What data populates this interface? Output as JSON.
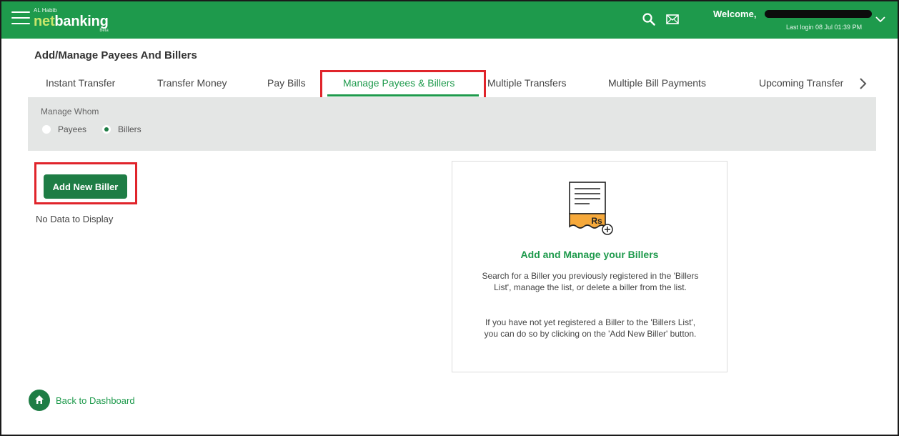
{
  "header": {
    "logo_small": "AL Habib",
    "logo_net": "net",
    "logo_banking": "banking",
    "logo_beta": "Beta",
    "welcome": "Welcome,",
    "last_login": "Last login 08 Jul 01:39 PM",
    "icons": [
      "menu-icon",
      "search-icon",
      "mail-icon",
      "chevron-down-icon"
    ]
  },
  "page": {
    "title": "Add/Manage Payees And Billers"
  },
  "tabs": [
    {
      "label": "Instant Transfer",
      "active": false
    },
    {
      "label": "Transfer Money",
      "active": false
    },
    {
      "label": "Pay Bills",
      "active": false
    },
    {
      "label": "Manage Payees & Billers",
      "active": true
    },
    {
      "label": "Multiple Transfers",
      "active": false
    },
    {
      "label": "Multiple Bill Payments",
      "active": false
    },
    {
      "label": "Upcoming Transfer",
      "active": false
    }
  ],
  "manage": {
    "label": "Manage Whom",
    "options": [
      {
        "label": "Payees",
        "selected": false
      },
      {
        "label": "Billers",
        "selected": true
      }
    ]
  },
  "billers": {
    "add_button": "Add New Biller",
    "empty_text": "No Data to Display"
  },
  "card": {
    "icon_currency": "Rs",
    "title": "Add and Manage your Billers",
    "text1": "Search for a Biller you previously registered in the 'Billers List', manage the list, or delete a biller from the list.",
    "text2": "If you have not yet registered a Biller to the 'Billers List', you can do so by clicking on the 'Add New Biller' button."
  },
  "footer": {
    "back_label": "Back to Dashboard"
  },
  "colors": {
    "brand_green": "#1e9a4c",
    "button_green": "#1e7d45",
    "annotation_red": "#e0242b",
    "panel_gray": "#e4e6e5",
    "receipt_orange": "#f6a93b"
  }
}
